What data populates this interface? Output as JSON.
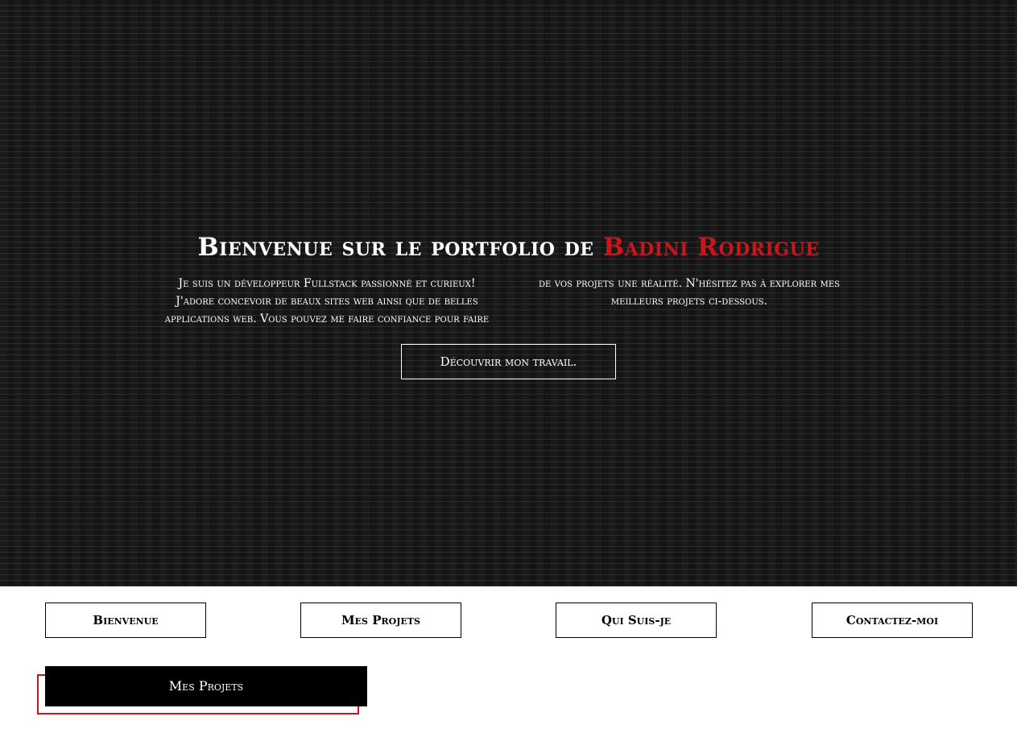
{
  "hero": {
    "title_prefix": "Bienvenue sur le portfolio de ",
    "title_name": "Badini Rodrigue",
    "intro": "Je suis un développeur Fullstack passionné et curieux! J'adore concevoir de beaux sites web ainsi que de belles applications web. Vous pouvez me faire confiance pour faire de vos projets une réalité. N'hésitez pas à explorer mes meilleurs projets ci-dessous.",
    "cta_label": "Découvrir mon travail."
  },
  "nav": {
    "items": [
      {
        "label": "Bienvenue"
      },
      {
        "label": "Mes Projets"
      },
      {
        "label": "Qui Suis-je"
      },
      {
        "label": "Contactez-moi"
      }
    ]
  },
  "projects_section": {
    "title": "Mes Projets"
  },
  "colors": {
    "accent": "#c8161d",
    "background_dark": "#141414",
    "text_light": "#ffffff"
  }
}
